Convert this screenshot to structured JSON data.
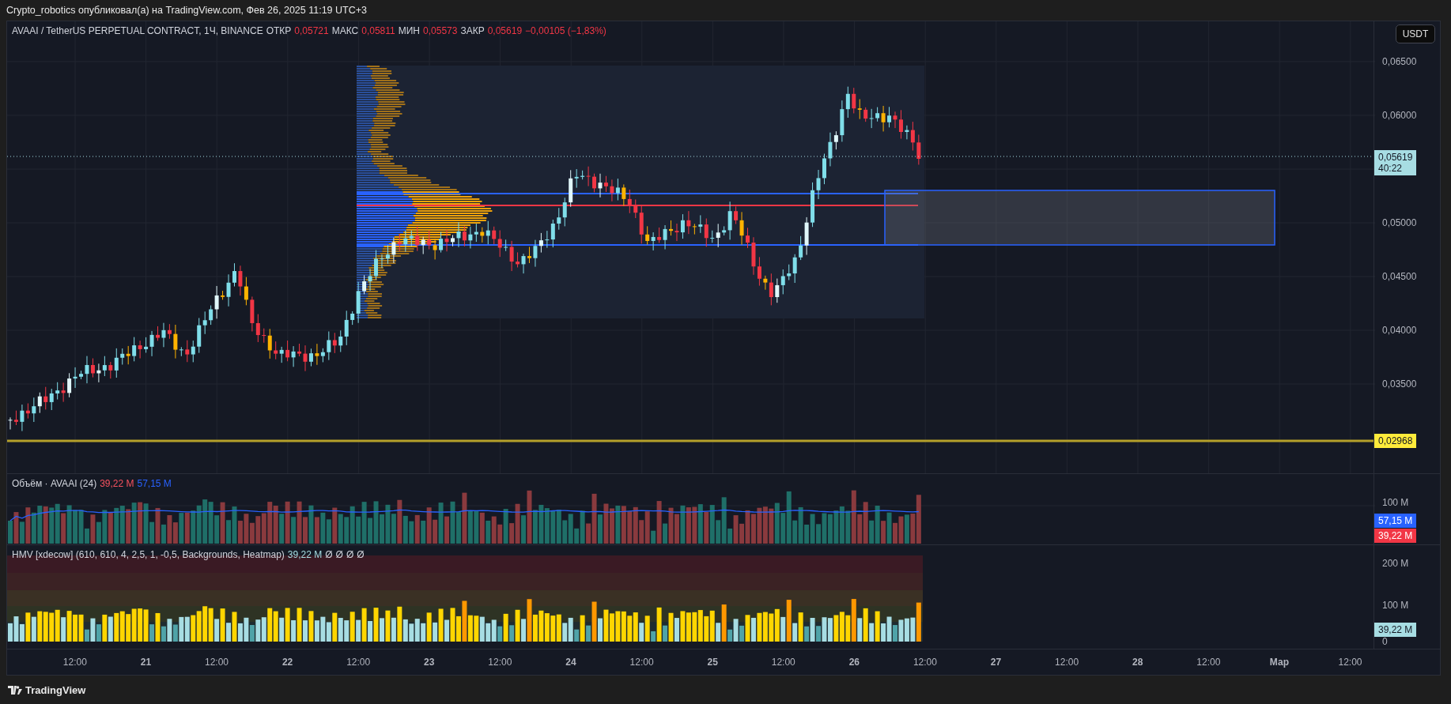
{
  "header": {
    "text": "Crypto_robotics опубликовал(а) на TradingView.com, Фев 26, 2025 11:19 UTC+3"
  },
  "legend": {
    "symbol": "AVAAI / TetherUS PERPETUAL CONTRACT, 1Ч, BINANCE",
    "ohlc": [
      {
        "label": "ОТКР",
        "value": "0,05721"
      },
      {
        "label": "МАКС",
        "value": "0,05811"
      },
      {
        "label": "МИН",
        "value": "0,05573"
      },
      {
        "label": "ЗАКР",
        "value": "0,05619"
      }
    ],
    "change": "−0,00105 (−1,83%)"
  },
  "currency_button": "USDT",
  "price_axis": {
    "upper_ticks": [
      "0,06500",
      "0,06000"
    ],
    "lower_ticks": [
      "0,05000",
      "0,04500",
      "0,04000",
      "0,03500"
    ]
  },
  "last_price": {
    "value": "0,05619",
    "countdown": "40:22"
  },
  "level_line": {
    "value": "0,02968"
  },
  "volume_pane": {
    "title": "Объём · AVAAI (24)",
    "values": [
      {
        "text": "39,22 M",
        "color": "#f7525f"
      },
      {
        "text": "57,15 M",
        "color": "#2962ff"
      }
    ],
    "axis": [
      "100 M"
    ],
    "badges": [
      {
        "text": "57,15 M",
        "color": "#2962ff"
      },
      {
        "text": "39,22 M",
        "color": "#f23645"
      }
    ]
  },
  "hmv_pane": {
    "title": "HMV [xdecow] (610, 610, 4, 2,5, 1, -0,5, Backgrounds, Heatmap)",
    "value": "39,22 M",
    "extras": [
      "Ø",
      "Ø",
      "Ø",
      "Ø"
    ],
    "axis": [
      "200 M",
      "100 M",
      "0"
    ],
    "badge": "39,22 M"
  },
  "time_axis": [
    "12:00",
    "21",
    "12:00",
    "22",
    "12:00",
    "23",
    "12:00",
    "24",
    "12:00",
    "25",
    "12:00",
    "26",
    "12:00",
    "27",
    "12:00",
    "28",
    "12:00",
    "Мар",
    "12:00"
  ],
  "footer": {
    "brand": "TradingView"
  }
}
